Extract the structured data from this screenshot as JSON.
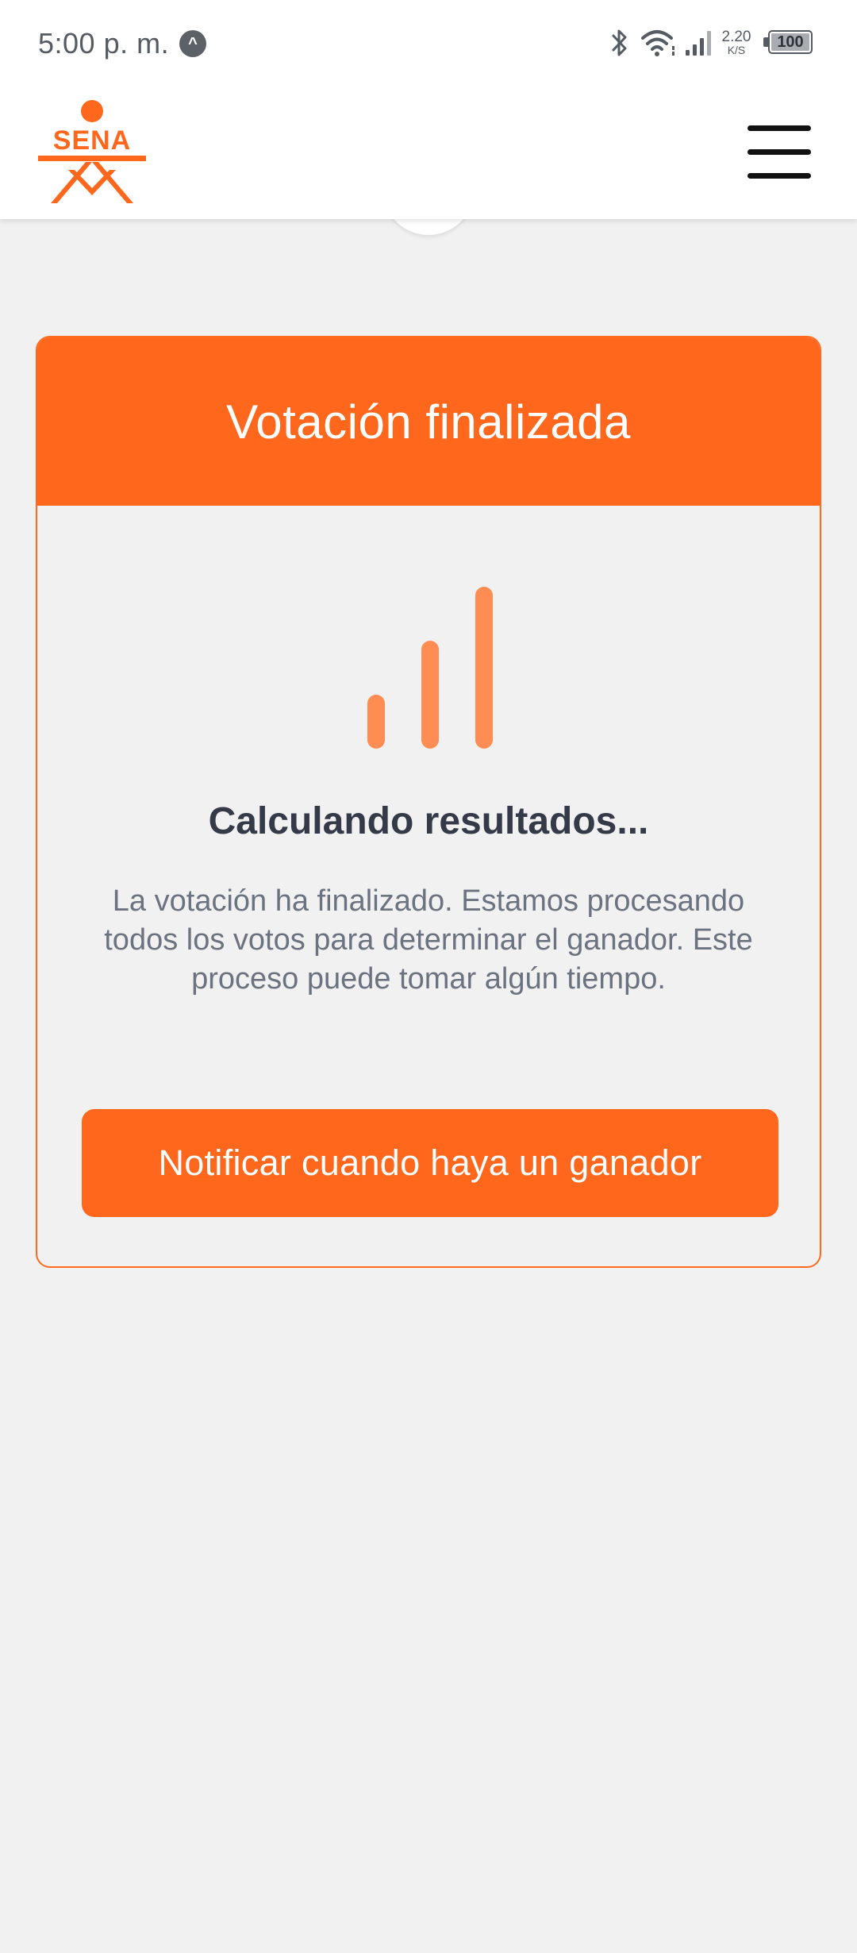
{
  "status_bar": {
    "time": "5:00 p. m.",
    "app_icon_glyph": "^",
    "net_speed_value": "2.20",
    "net_speed_unit": "K/S",
    "battery": "100",
    "icons": [
      "bluetooth-icon",
      "wifi-icon",
      "signal-icon",
      "battery-icon"
    ]
  },
  "header": {
    "logo_text": "SENA",
    "menu_icon": "hamburger-menu-icon"
  },
  "card": {
    "title": "Votación finalizada",
    "subtitle": "Calculando resultados...",
    "body": "La votación ha finalizado. Estamos procesando todos los votos para determinar el ganador. Este proceso puede tomar algún tiempo.",
    "button_label": "Notificar cuando haya un ganador",
    "icon": "bar-chart-icon"
  },
  "colors": {
    "brand_orange": "#ff671d",
    "light_orange": "#ff8c52",
    "background": "#f1f1f1",
    "heading_text": "#343a48",
    "body_text": "#6b7280"
  }
}
